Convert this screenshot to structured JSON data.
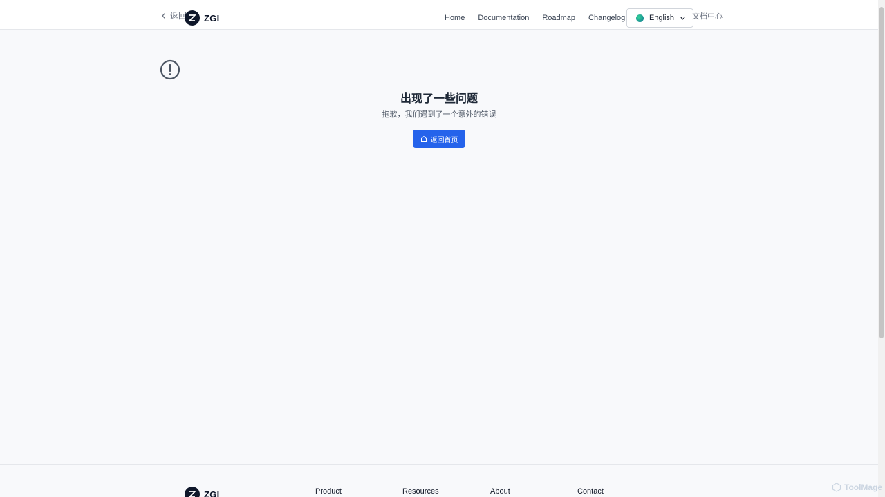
{
  "header": {
    "back_label": "返回",
    "logo_text": "ZGI",
    "nav": [
      "Home",
      "Documentation",
      "Roadmap",
      "Changelog"
    ],
    "language": "English",
    "doc_center": "文档中心"
  },
  "error": {
    "title": "出现了一些问题",
    "description": "抱歉，我们遇到了一个意外的错误",
    "home_button": "返回首页"
  },
  "footer": {
    "logo_text": "ZGI",
    "columns": [
      "Product",
      "Resources",
      "About",
      "Contact"
    ]
  },
  "watermark": "ToolMage",
  "colors": {
    "primary": "#2563eb",
    "background": "#f8f9fb",
    "text": "#1f2937"
  }
}
